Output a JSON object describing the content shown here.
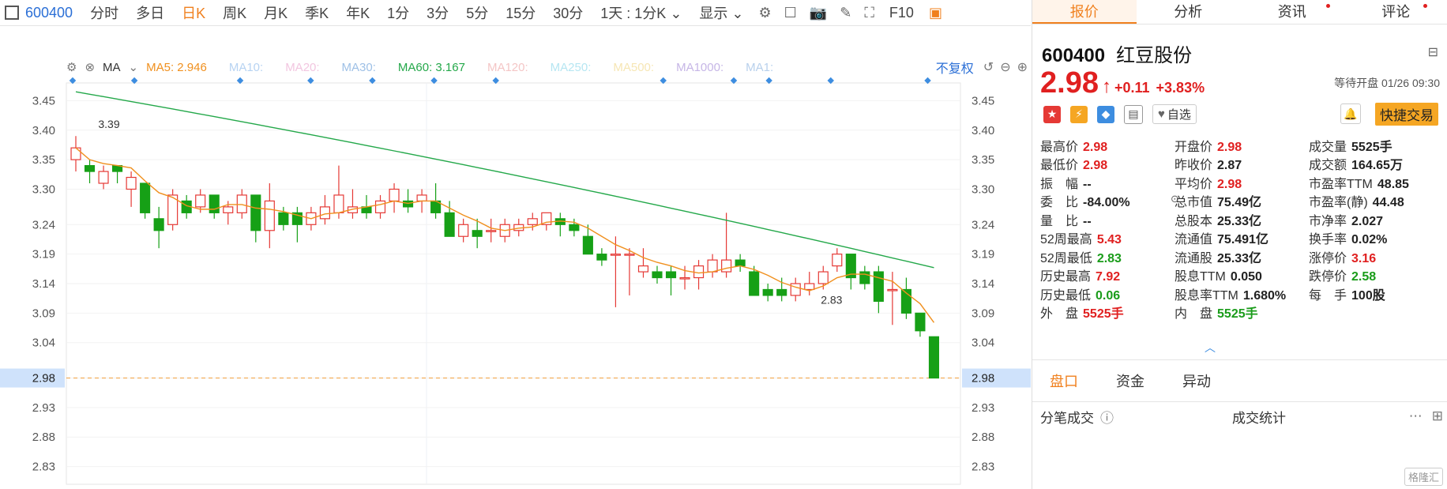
{
  "toolbar": {
    "code": "600400",
    "periods": [
      "分时",
      "多日",
      "日K",
      "周K",
      "月K",
      "季K",
      "年K",
      "1分",
      "3分",
      "5分",
      "15分",
      "30分"
    ],
    "active_period": "日K",
    "dropdown": "1天 : 1分K",
    "display": "显示",
    "f10": "F10"
  },
  "ma_bar": {
    "label": "MA",
    "items": [
      {
        "text": "MA5: 2.946",
        "color": "#f0901e"
      },
      {
        "text": "MA10:",
        "color": "#b7d3f2"
      },
      {
        "text": "MA20:",
        "color": "#f2c6e0"
      },
      {
        "text": "MA30:",
        "color": "#9ec0e6"
      },
      {
        "text": "MA60: 3.167",
        "color": "#24a84a"
      },
      {
        "text": "MA120:",
        "color": "#f4c6c6"
      },
      {
        "text": "MA250:",
        "color": "#b6e6f2"
      },
      {
        "text": "MA500:",
        "color": "#f6e6b4"
      },
      {
        "text": "MA1000:",
        "color": "#c6b6e6"
      },
      {
        "text": "MA1:",
        "color": "#b8d0ec"
      }
    ],
    "adjust": "不复权"
  },
  "panel": {
    "tabs": [
      "报价",
      "分析",
      "资讯",
      "评论"
    ],
    "code": "600400",
    "name": "红豆股份",
    "price": "2.98",
    "change": "+0.11",
    "change_pct": "+3.83%",
    "status": "等待开盘 01/26 09:30",
    "zixuan": "自选",
    "fast_trade": "快捷交易",
    "stats": [
      [
        {
          "l": "最高价",
          "v": "2.98",
          "c": "red"
        },
        {
          "l": "开盘价",
          "v": "2.98",
          "c": "red"
        },
        {
          "l": "成交量",
          "v": "5525手",
          "c": ""
        }
      ],
      [
        {
          "l": "最低价",
          "v": "2.98",
          "c": "red"
        },
        {
          "l": "昨收价",
          "v": "2.87",
          "c": ""
        },
        {
          "l": "成交额",
          "v": "164.65万",
          "c": ""
        }
      ],
      [
        {
          "l": "振　幅",
          "v": "--",
          "c": ""
        },
        {
          "l": "平均价",
          "v": "2.98",
          "c": "red"
        },
        {
          "l": "市盈率TTM",
          "v": "48.85",
          "c": ""
        }
      ],
      [
        {
          "l": "委　比",
          "v": "-84.00%",
          "c": ""
        },
        {
          "l": "总市值",
          "v": "75.49亿",
          "c": ""
        },
        {
          "l": "市盈率(静)",
          "v": "44.48",
          "c": ""
        }
      ],
      [
        {
          "l": "量　比",
          "v": "--",
          "c": ""
        },
        {
          "l": "总股本",
          "v": "25.33亿",
          "c": ""
        },
        {
          "l": "市净率",
          "v": "2.027",
          "c": ""
        }
      ],
      [
        {
          "l": "52周最高",
          "v": "5.43",
          "c": "red"
        },
        {
          "l": "流通值",
          "v": "75.491亿",
          "c": ""
        },
        {
          "l": "换手率",
          "v": "0.02%",
          "c": ""
        }
      ],
      [
        {
          "l": "52周最低",
          "v": "2.83",
          "c": "green"
        },
        {
          "l": "流通股",
          "v": "25.33亿",
          "c": ""
        },
        {
          "l": "涨停价",
          "v": "3.16",
          "c": "red"
        }
      ],
      [
        {
          "l": "历史最高",
          "v": "7.92",
          "c": "red"
        },
        {
          "l": "股息TTM",
          "v": "0.050",
          "c": ""
        },
        {
          "l": "跌停价",
          "v": "2.58",
          "c": "green"
        }
      ],
      [
        {
          "l": "历史最低",
          "v": "0.06",
          "c": "green"
        },
        {
          "l": "股息率TTM",
          "v": "1.680%",
          "c": ""
        },
        {
          "l": "每　手",
          "v": "100股",
          "c": ""
        }
      ],
      [
        {
          "l": "外　盘",
          "v": "5525手",
          "c": "red"
        },
        {
          "l": "内　盘",
          "v": "5525手",
          "c": "green"
        },
        {
          "l": "",
          "v": "",
          "c": ""
        }
      ]
    ],
    "sub_tabs": [
      "盘口",
      "资金",
      "异动"
    ],
    "trade_left": "分笔成交",
    "trade_center": "成交统计"
  },
  "watermark": "格隆汇",
  "chart_data": {
    "type": "candlestick",
    "ylim": [
      2.8,
      3.48
    ],
    "y_ticks": [
      "3.45",
      "3.40",
      "3.35",
      "3.30",
      "3.24",
      "3.19",
      "3.14",
      "3.09",
      "3.04",
      "2.98",
      "2.93",
      "2.88",
      "2.83"
    ],
    "current_price": "2.98",
    "annotations": [
      {
        "text": "3.39",
        "index": 0
      },
      {
        "text": "2.83",
        "index": 57
      }
    ],
    "candles": [
      {
        "o": 3.35,
        "h": 3.39,
        "l": 3.33,
        "c": 3.37
      },
      {
        "o": 3.34,
        "h": 3.35,
        "l": 3.31,
        "c": 3.33
      },
      {
        "o": 3.31,
        "h": 3.34,
        "l": 3.3,
        "c": 3.33
      },
      {
        "o": 3.34,
        "h": 3.34,
        "l": 3.31,
        "c": 3.33
      },
      {
        "o": 3.3,
        "h": 3.33,
        "l": 3.27,
        "c": 3.32
      },
      {
        "o": 3.31,
        "h": 3.31,
        "l": 3.25,
        "c": 3.26
      },
      {
        "o": 3.25,
        "h": 3.27,
        "l": 3.2,
        "c": 3.23
      },
      {
        "o": 3.24,
        "h": 3.3,
        "l": 3.23,
        "c": 3.29
      },
      {
        "o": 3.28,
        "h": 3.29,
        "l": 3.25,
        "c": 3.26
      },
      {
        "o": 3.27,
        "h": 3.3,
        "l": 3.26,
        "c": 3.29
      },
      {
        "o": 3.29,
        "h": 3.29,
        "l": 3.25,
        "c": 3.26
      },
      {
        "o": 3.26,
        "h": 3.28,
        "l": 3.24,
        "c": 3.27
      },
      {
        "o": 3.26,
        "h": 3.3,
        "l": 3.25,
        "c": 3.29
      },
      {
        "o": 3.29,
        "h": 3.29,
        "l": 3.21,
        "c": 3.23
      },
      {
        "o": 3.23,
        "h": 3.31,
        "l": 3.2,
        "c": 3.28
      },
      {
        "o": 3.26,
        "h": 3.27,
        "l": 3.23,
        "c": 3.24
      },
      {
        "o": 3.26,
        "h": 3.27,
        "l": 3.21,
        "c": 3.24
      },
      {
        "o": 3.24,
        "h": 3.27,
        "l": 3.23,
        "c": 3.26
      },
      {
        "o": 3.25,
        "h": 3.29,
        "l": 3.24,
        "c": 3.27
      },
      {
        "o": 3.26,
        "h": 3.34,
        "l": 3.25,
        "c": 3.29
      },
      {
        "o": 3.26,
        "h": 3.3,
        "l": 3.25,
        "c": 3.27
      },
      {
        "o": 3.27,
        "h": 3.29,
        "l": 3.25,
        "c": 3.26
      },
      {
        "o": 3.26,
        "h": 3.29,
        "l": 3.25,
        "c": 3.28
      },
      {
        "o": 3.28,
        "h": 3.31,
        "l": 3.26,
        "c": 3.3
      },
      {
        "o": 3.28,
        "h": 3.3,
        "l": 3.26,
        "c": 3.27
      },
      {
        "o": 3.28,
        "h": 3.3,
        "l": 3.26,
        "c": 3.29
      },
      {
        "o": 3.28,
        "h": 3.31,
        "l": 3.25,
        "c": 3.26
      },
      {
        "o": 3.26,
        "h": 3.28,
        "l": 3.22,
        "c": 3.22
      },
      {
        "o": 3.22,
        "h": 3.25,
        "l": 3.21,
        "c": 3.24
      },
      {
        "o": 3.23,
        "h": 3.25,
        "l": 3.2,
        "c": 3.22
      },
      {
        "o": 3.23,
        "h": 3.25,
        "l": 3.21,
        "c": 3.23
      },
      {
        "o": 3.22,
        "h": 3.25,
        "l": 3.21,
        "c": 3.24
      },
      {
        "o": 3.23,
        "h": 3.25,
        "l": 3.22,
        "c": 3.24
      },
      {
        "o": 3.24,
        "h": 3.26,
        "l": 3.23,
        "c": 3.25
      },
      {
        "o": 3.24,
        "h": 3.26,
        "l": 3.23,
        "c": 3.26
      },
      {
        "o": 3.25,
        "h": 3.26,
        "l": 3.22,
        "c": 3.24
      },
      {
        "o": 3.24,
        "h": 3.25,
        "l": 3.22,
        "c": 3.23
      },
      {
        "o": 3.22,
        "h": 3.24,
        "l": 3.19,
        "c": 3.19
      },
      {
        "o": 3.19,
        "h": 3.2,
        "l": 3.17,
        "c": 3.18
      },
      {
        "o": 3.19,
        "h": 3.22,
        "l": 3.1,
        "c": 3.19
      },
      {
        "o": 3.19,
        "h": 3.2,
        "l": 3.12,
        "c": 3.19
      },
      {
        "o": 3.16,
        "h": 3.2,
        "l": 3.15,
        "c": 3.17
      },
      {
        "o": 3.16,
        "h": 3.17,
        "l": 3.14,
        "c": 3.15
      },
      {
        "o": 3.16,
        "h": 3.17,
        "l": 3.12,
        "c": 3.15
      },
      {
        "o": 3.15,
        "h": 3.17,
        "l": 3.13,
        "c": 3.15
      },
      {
        "o": 3.15,
        "h": 3.18,
        "l": 3.13,
        "c": 3.17
      },
      {
        "o": 3.16,
        "h": 3.19,
        "l": 3.15,
        "c": 3.18
      },
      {
        "o": 3.16,
        "h": 3.26,
        "l": 3.15,
        "c": 3.18
      },
      {
        "o": 3.18,
        "h": 3.19,
        "l": 3.16,
        "c": 3.17
      },
      {
        "o": 3.16,
        "h": 3.17,
        "l": 3.12,
        "c": 3.12
      },
      {
        "o": 3.13,
        "h": 3.14,
        "l": 3.11,
        "c": 3.12
      },
      {
        "o": 3.13,
        "h": 3.15,
        "l": 3.11,
        "c": 3.12
      },
      {
        "o": 3.12,
        "h": 3.15,
        "l": 3.11,
        "c": 3.14
      },
      {
        "o": 3.13,
        "h": 3.16,
        "l": 3.12,
        "c": 3.14
      },
      {
        "o": 3.14,
        "h": 3.17,
        "l": 3.13,
        "c": 3.16
      },
      {
        "o": 3.17,
        "h": 3.2,
        "l": 3.16,
        "c": 3.19
      },
      {
        "o": 3.19,
        "h": 3.19,
        "l": 3.13,
        "c": 3.15
      },
      {
        "o": 3.16,
        "h": 3.17,
        "l": 3.13,
        "c": 3.14
      },
      {
        "o": 3.16,
        "h": 3.17,
        "l": 3.09,
        "c": 3.11
      },
      {
        "o": 3.13,
        "h": 3.16,
        "l": 3.07,
        "c": 3.13
      },
      {
        "o": 3.13,
        "h": 3.15,
        "l": 3.08,
        "c": 3.09
      },
      {
        "o": 3.09,
        "h": 3.09,
        "l": 3.05,
        "c": 3.06
      },
      {
        "o": 3.05,
        "h": 3.05,
        "l": 2.99,
        "c": 2.98
      }
    ],
    "ma5_end": 2.946,
    "ma60_end": 3.167
  }
}
